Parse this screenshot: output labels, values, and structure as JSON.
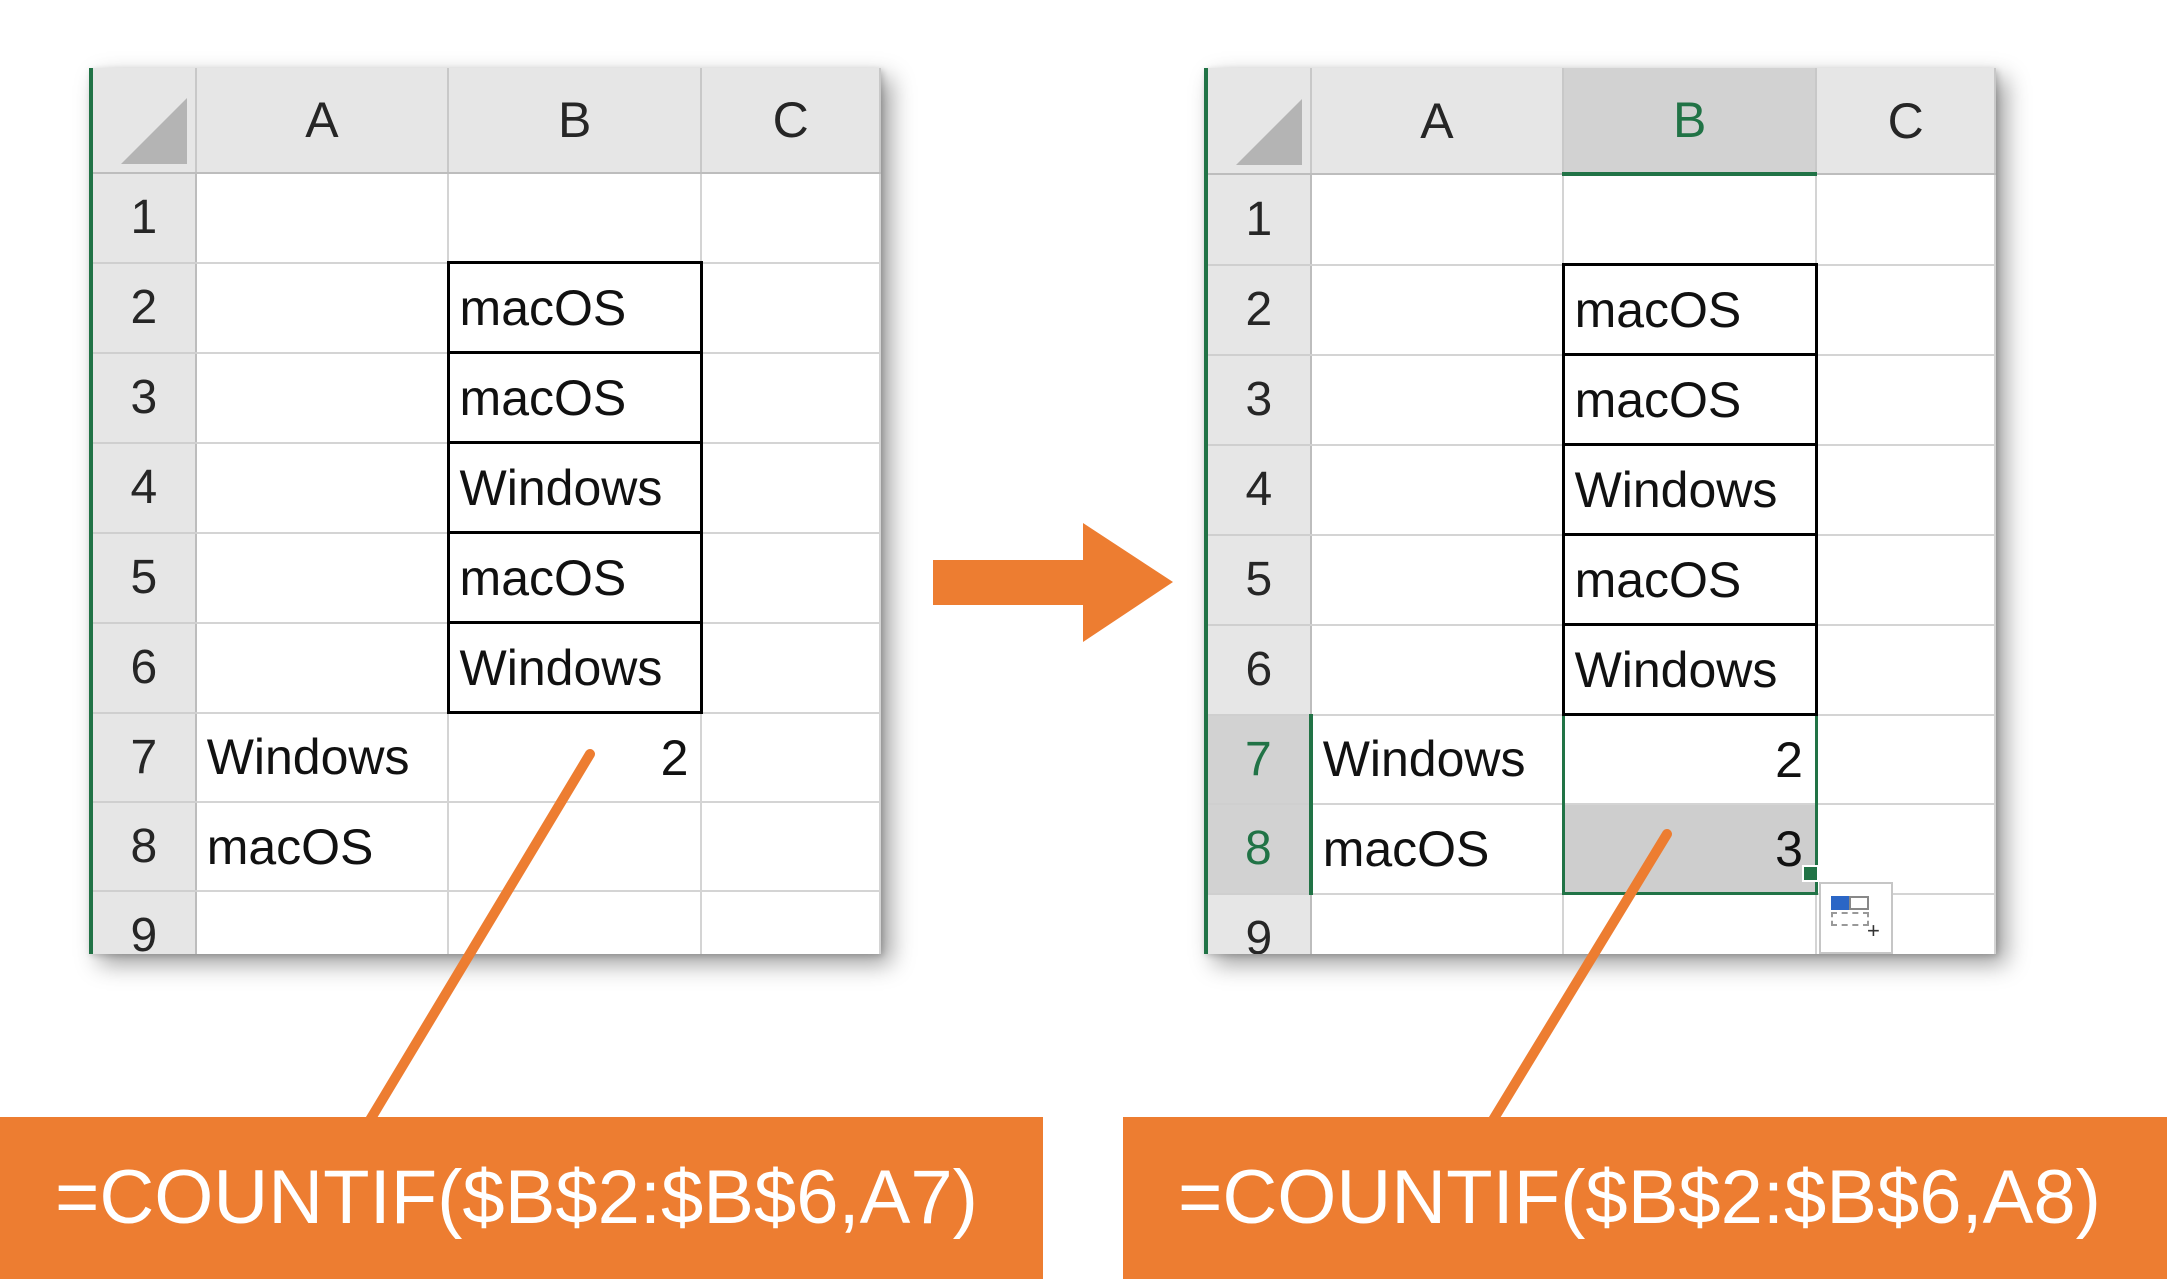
{
  "colors": {
    "accent_orange": "#ed7d31",
    "excel_green": "#217346",
    "header_gray": "#e6e6e6",
    "selection_gray": "#cecece"
  },
  "left_sheet": {
    "columns": [
      "A",
      "B",
      "C"
    ],
    "rows": [
      "1",
      "2",
      "3",
      "4",
      "5",
      "6",
      "7",
      "8",
      "9"
    ],
    "cells": {
      "B2": "macOS",
      "B3": "macOS",
      "B4": "Windows",
      "B5": "macOS",
      "B6": "Windows",
      "A7": "Windows",
      "B7": "2",
      "A8": "macOS"
    }
  },
  "right_sheet": {
    "columns": [
      "A",
      "B",
      "C"
    ],
    "rows": [
      "1",
      "2",
      "3",
      "4",
      "5",
      "6",
      "7",
      "8",
      "9"
    ],
    "selected_column": "B",
    "selected_rows": [
      "7",
      "8"
    ],
    "cells": {
      "B2": "macOS",
      "B3": "macOS",
      "B4": "Windows",
      "B5": "macOS",
      "B6": "Windows",
      "A7": "Windows",
      "B7": "2",
      "A8": "macOS",
      "B8": "3"
    },
    "quick_analysis_icon": "quick-analysis-icon"
  },
  "callouts": {
    "left_formula": "=COUNTIF($B$2:$B$6,A7)",
    "right_formula": "=COUNTIF($B$2:$B$6,A8)"
  },
  "arrow_icon": "right-arrow-icon"
}
